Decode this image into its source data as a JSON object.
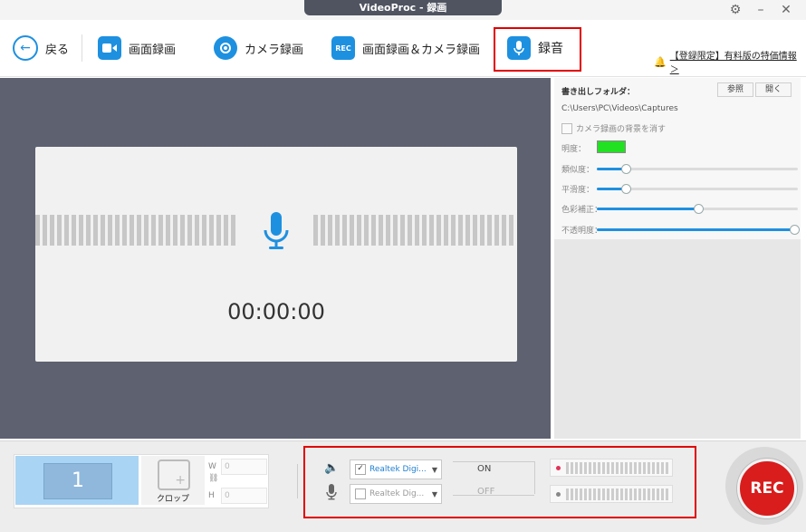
{
  "window": {
    "title": "VideoProc - 録画",
    "settings_icon": "gear-icon",
    "minimize_icon": "minimize-icon",
    "close_icon": "close-icon"
  },
  "toolbar": {
    "back_label": "戻る",
    "screen_record_label": "画面録画",
    "camera_record_label": "カメラ録画",
    "screen_camera_label": "画面録画＆カメラ録画",
    "audio_label": "録音",
    "promo_label": "【登録限定】有料版の特価情報 ＞",
    "accent": "#1e90e0",
    "highlight": "#e00000"
  },
  "preview": {
    "timer": "00:00:00",
    "mic_icon": "microphone-icon"
  },
  "settings": {
    "output_folder_label": "書き出しフォルダ：",
    "browse_label": "参照",
    "open_label": "開く",
    "path": "C:\\Users\\PC\\Videos\\Captures",
    "remove_bg_label": "カメラ録画の背景を消す",
    "brightness_label": "明度：",
    "brightness_color": "#22e022",
    "similarity_label": "類似度：",
    "similarity_value": 0.14,
    "smoothness_label": "平滑度：",
    "smoothness_value": 0.14,
    "color_correct_label": "色彩補正：",
    "color_correct_value": 0.5,
    "opacity_label": "不透明度：",
    "opacity_value": 1.0
  },
  "bottom": {
    "monitor_number": "1",
    "crop_label": "クロップ",
    "w_label": "W",
    "w_value": "0",
    "h_label": "H",
    "h_value": "0",
    "speaker_device": "Realtek Digi...",
    "mic_device": "Realtek Dig...",
    "on_label": "ON",
    "off_label": "OFF",
    "rec_label": "REC",
    "rec_color": "#d91c1c"
  }
}
